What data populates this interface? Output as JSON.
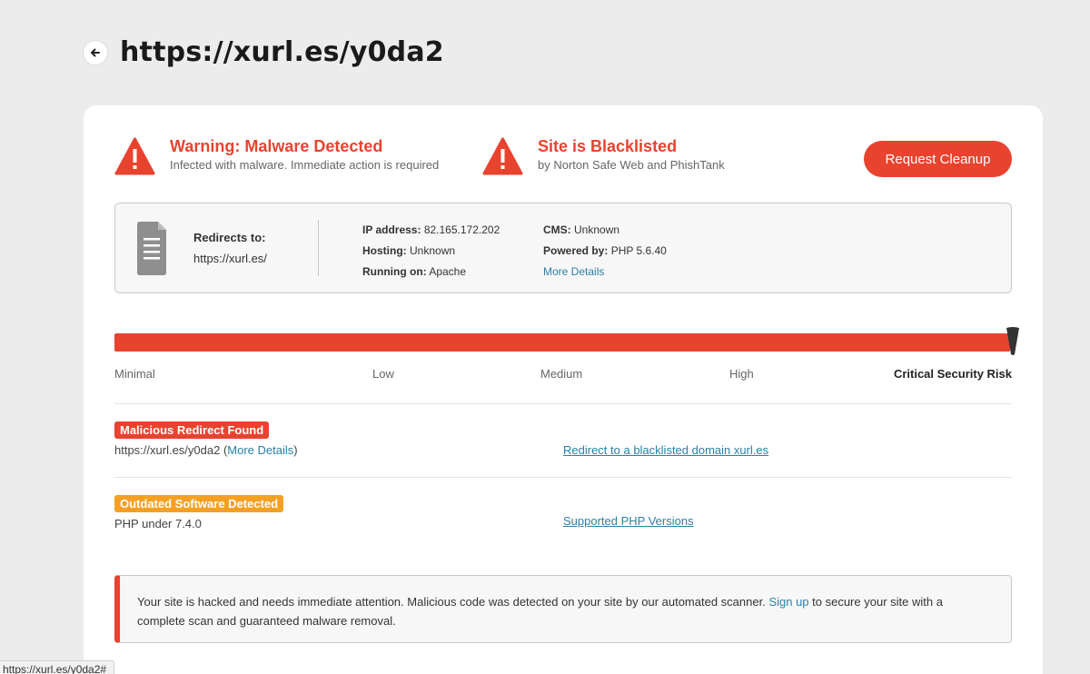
{
  "page": {
    "title": "https://xurl.es/y0da2"
  },
  "alerts": [
    {
      "title": "Warning: Malware Detected",
      "subtitle": "Infected with malware. Immediate action is required"
    },
    {
      "title": "Site is Blacklisted",
      "subtitle": "by Norton Safe Web and PhishTank"
    }
  ],
  "cta": {
    "label": "Request Cleanup"
  },
  "site_info": {
    "redirect_label": "Redirects to:",
    "redirect_value": "https://xurl.es/",
    "ip_label": "IP address:",
    "ip_value": "82.165.172.202",
    "hosting_label": "Hosting:",
    "hosting_value": "Unknown",
    "running_label": "Running on:",
    "running_value": "Apache",
    "cms_label": "CMS:",
    "cms_value": "Unknown",
    "powered_label": "Powered by:",
    "powered_value": "PHP 5.6.40",
    "more_details": "More Details"
  },
  "risk_meter": {
    "labels": [
      "Minimal",
      "Low",
      "Medium",
      "High",
      "Critical Security Risk"
    ],
    "current_level": "Critical Security Risk",
    "fill_percent": 100
  },
  "issues": [
    {
      "badge": "Malicious Redirect Found",
      "badge_color": "#e8432f",
      "desc_prefix": "https://xurl.es/y0da2 (",
      "desc_link": "More Details",
      "desc_suffix": ")",
      "link": "Redirect to a blacklisted domain xurl.es"
    },
    {
      "badge": "Outdated Software Detected",
      "badge_color": "#f5a023",
      "desc": "PHP under 7.4.0",
      "link": "Supported PHP Versions"
    }
  ],
  "notice": {
    "text_before": "Your site is hacked and needs immediate attention. Malicious code was detected on your site by our automated scanner. ",
    "link": "Sign up",
    "text_after": " to secure your site with a complete scan and guaranteed malware removal."
  },
  "status_bar": {
    "url": "https://xurl.es/y0da2#"
  },
  "colors": {
    "danger": "#e8432f",
    "warning": "#f5a023",
    "link": "#2c7fa8",
    "background": "#ececec"
  },
  "icons": [
    "back-arrow-icon",
    "warning-triangle-icon",
    "document-icon",
    "risk-needle-icon"
  ]
}
